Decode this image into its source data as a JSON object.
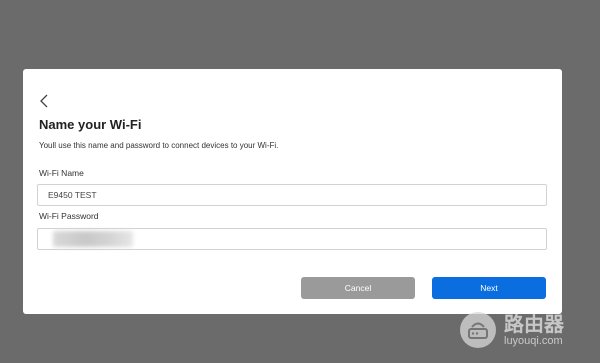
{
  "dialog": {
    "title": "Name your Wi-Fi",
    "description": "Youll use this name and password to connect devices to your Wi-Fi.",
    "wifi_name": {
      "label": "Wi-Fi Name",
      "value": "E9450 TEST"
    },
    "wifi_password": {
      "label": "Wi-Fi Password",
      "value": ""
    },
    "buttons": {
      "cancel": "Cancel",
      "next": "Next"
    }
  },
  "watermark": {
    "text_cn": "路由器",
    "text_en": "luyouqi.com"
  },
  "colors": {
    "backdrop": "#6b6b6b",
    "primary": "#0a6ee0",
    "cancel": "#9a9a9a"
  },
  "icons": {
    "back": "chevron-left-icon",
    "watermark_logo": "router-icon"
  }
}
